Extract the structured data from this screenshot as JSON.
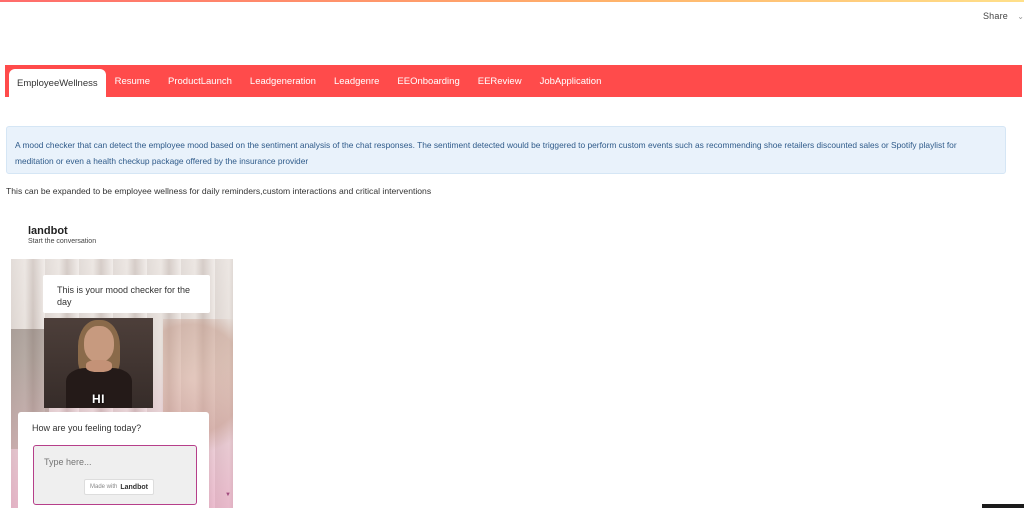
{
  "header": {
    "share_label": "Share",
    "menu_caret": "⌄"
  },
  "tabs": [
    {
      "label": "EmployeeWellness",
      "active": true
    },
    {
      "label": "Resume",
      "active": false
    },
    {
      "label": "ProductLaunch",
      "active": false
    },
    {
      "label": "Leadgeneration",
      "active": false
    },
    {
      "label": "Leadgenre",
      "active": false
    },
    {
      "label": "EEOnboarding",
      "active": false
    },
    {
      "label": "EEReview",
      "active": false
    },
    {
      "label": "JobApplication",
      "active": false
    }
  ],
  "info": {
    "text": "A mood checker that can detect the employee mood based on the sentiment analysis of the chat responses. The sentiment detected would be triggered to perform custom events such as recommending shoe retailers discounted sales or Spotify playlist for meditation or even a health checkup package offered by the insurance provider"
  },
  "body_text": "This can be expanded to be employee wellness for daily reminders,custom interactions and critical interventions",
  "bot": {
    "title": "landbot",
    "subtitle": "Start the conversation",
    "greeting": "This is your mood checker for the day",
    "gif_caption": "HI",
    "question": "How are you feeling today?",
    "input_placeholder": "Type here...",
    "made_with_prefix": "Made with",
    "made_with_brand": "Landbot"
  },
  "colors": {
    "tab_bar": "#ff4b4b",
    "info_bg": "#e9f2fb",
    "info_text": "#2f5b8a",
    "input_border": "#b63f8a"
  }
}
